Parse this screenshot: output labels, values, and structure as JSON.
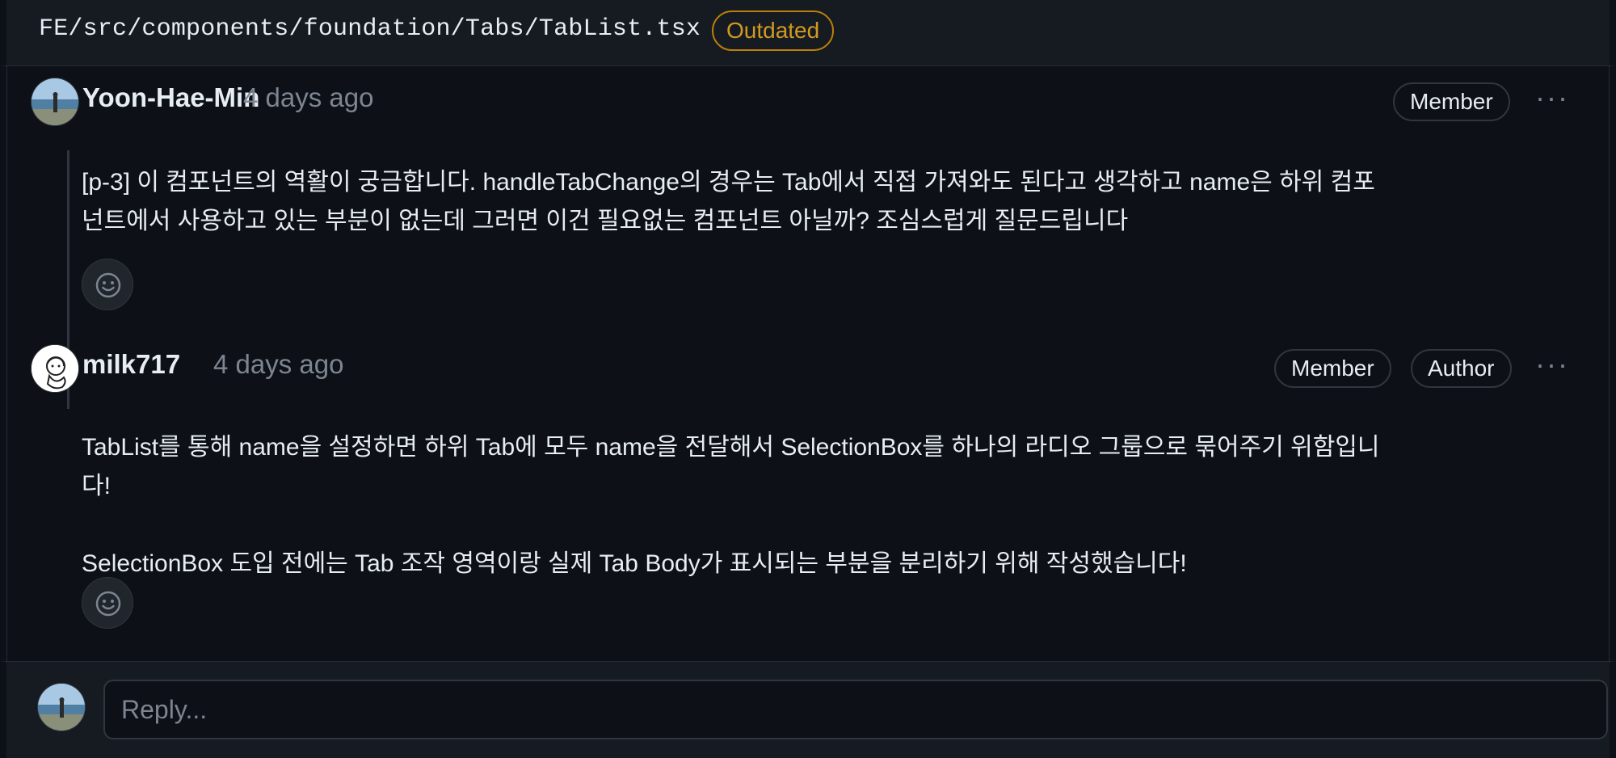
{
  "header": {
    "file_path": "FE/src/components/foundation/Tabs/TabList.tsx",
    "status_badge": "Outdated"
  },
  "comments": [
    {
      "author": "Yoon-Hae-Min",
      "time": "4 days ago",
      "badges": [
        "Member"
      ],
      "body": "[p-3] 이 컴포넌트의 역활이 궁금합니다. handleTabChange의 경우는 Tab에서 직접 가져와도 된다고 생각하고 name은 하위 컴포\n넌트에서 사용하고 있는 부분이 없는데 그러면 이건 필요없는 컴포넌트 아닐까? 조심스럽게 질문드립니다"
    },
    {
      "author": "milk717",
      "time": "4 days ago",
      "badges": [
        "Member",
        "Author"
      ],
      "body": "TabList를 통해 name을 설정하면 하위 Tab에 모두 name을 전달해서 SelectionBox를 하나의 라디오 그룹으로 묶어주기 위함입니\n다!\n\nSelectionBox 도입 전에는 Tab 조작 영역이랑 실제 Tab Body가 표시되는 부분을 분리하기 위해 작성했습니다!"
    }
  ],
  "reply": {
    "placeholder": "Reply..."
  },
  "icons": {
    "more": "kebab-horizontal-icon",
    "reaction": "smiley-icon"
  },
  "colors": {
    "background": "#0d1117",
    "header_bg": "#161b22",
    "outdated": "#d29922",
    "muted": "#7d8590",
    "border": "#30363d"
  }
}
